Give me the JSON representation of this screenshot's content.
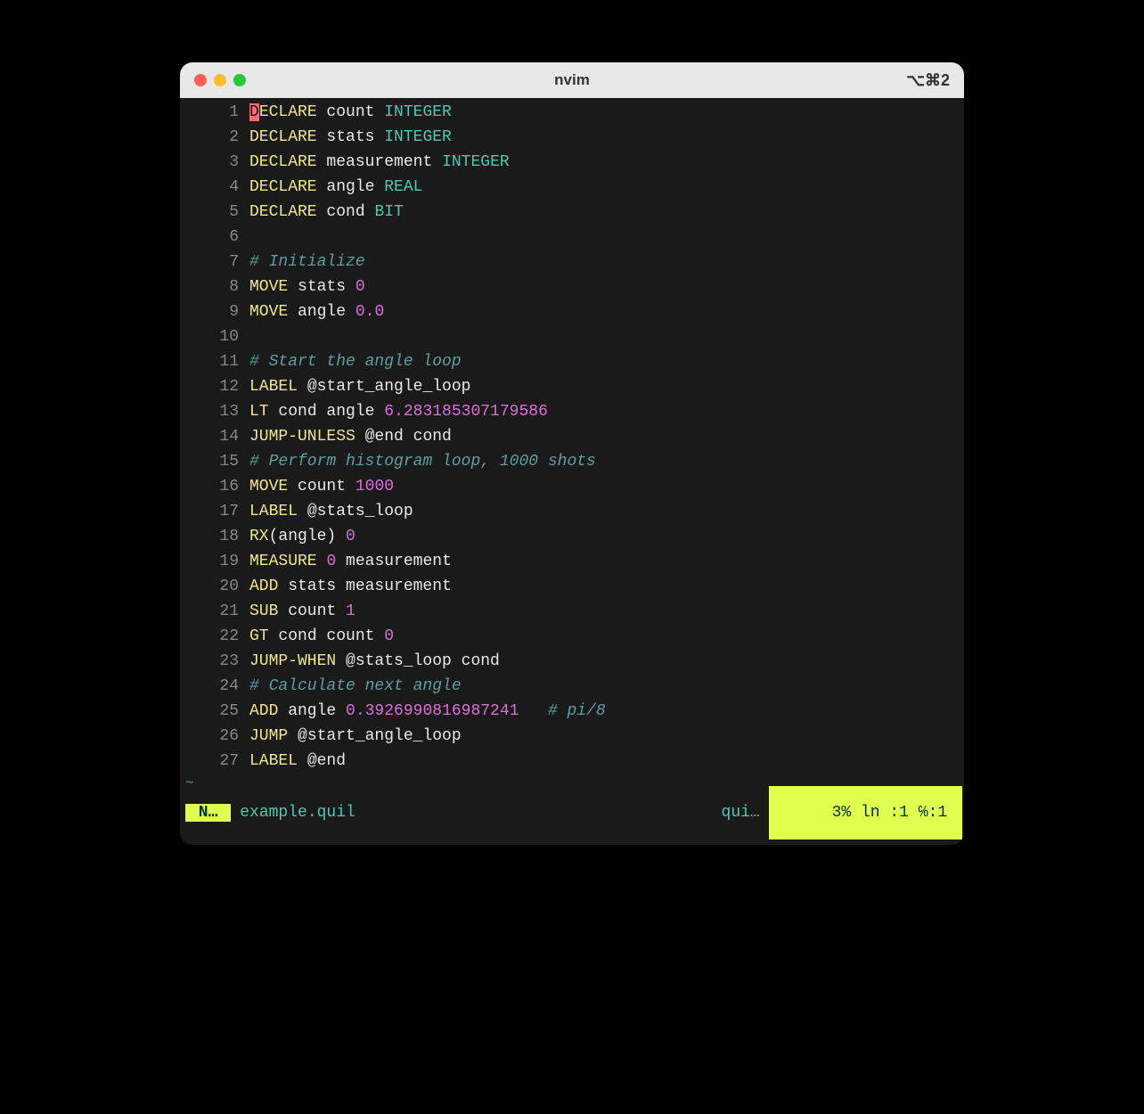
{
  "window": {
    "title": "nvim",
    "shortcut": "⌥⌘2"
  },
  "statusbar": {
    "mode": " N… ",
    "filename": "example.quil",
    "filetype": "qui…",
    "percent": "3%",
    "position": " ln :1 ℅:1 "
  },
  "tilde": "~",
  "lines": [
    {
      "num": "1",
      "tokens": [
        [
          "cursor",
          "D"
        ],
        [
          "kw",
          "ECLARE"
        ],
        [
          "ident",
          " count "
        ],
        [
          "type",
          "INTEGER"
        ]
      ]
    },
    {
      "num": "2",
      "tokens": [
        [
          "kw",
          "DECLARE"
        ],
        [
          "ident",
          " stats "
        ],
        [
          "type",
          "INTEGER"
        ]
      ]
    },
    {
      "num": "3",
      "tokens": [
        [
          "kw",
          "DECLARE"
        ],
        [
          "ident",
          " measurement "
        ],
        [
          "type",
          "INTEGER"
        ]
      ]
    },
    {
      "num": "4",
      "tokens": [
        [
          "kw",
          "DECLARE"
        ],
        [
          "ident",
          " angle "
        ],
        [
          "type",
          "REAL"
        ]
      ]
    },
    {
      "num": "5",
      "tokens": [
        [
          "kw",
          "DECLARE"
        ],
        [
          "ident",
          " cond "
        ],
        [
          "type",
          "BIT"
        ]
      ]
    },
    {
      "num": "6",
      "tokens": []
    },
    {
      "num": "7",
      "tokens": [
        [
          "comment",
          "# Initialize"
        ]
      ]
    },
    {
      "num": "8",
      "tokens": [
        [
          "kw",
          "MOVE"
        ],
        [
          "ident",
          " stats "
        ],
        [
          "num",
          "0"
        ]
      ]
    },
    {
      "num": "9",
      "tokens": [
        [
          "kw",
          "MOVE"
        ],
        [
          "ident",
          " angle "
        ],
        [
          "num",
          "0.0"
        ]
      ]
    },
    {
      "num": "10",
      "tokens": []
    },
    {
      "num": "11",
      "tokens": [
        [
          "comment",
          "# Start the angle loop"
        ]
      ]
    },
    {
      "num": "12",
      "tokens": [
        [
          "kw",
          "LABEL"
        ],
        [
          "ident",
          " @start_angle_loop"
        ]
      ]
    },
    {
      "num": "13",
      "tokens": [
        [
          "kw",
          "LT"
        ],
        [
          "ident",
          " cond angle "
        ],
        [
          "num",
          "6.283185307179586"
        ]
      ]
    },
    {
      "num": "14",
      "tokens": [
        [
          "kw",
          "JUMP-UNLESS"
        ],
        [
          "ident",
          " @end cond"
        ]
      ]
    },
    {
      "num": "15",
      "tokens": [
        [
          "comment",
          "# Perform histogram loop, 1000 shots"
        ]
      ]
    },
    {
      "num": "16",
      "tokens": [
        [
          "kw",
          "MOVE"
        ],
        [
          "ident",
          " count "
        ],
        [
          "num",
          "1000"
        ]
      ]
    },
    {
      "num": "17",
      "tokens": [
        [
          "kw",
          "LABEL"
        ],
        [
          "ident",
          " @stats_loop"
        ]
      ]
    },
    {
      "num": "18",
      "tokens": [
        [
          "kw",
          "RX"
        ],
        [
          "ident",
          "(angle) "
        ],
        [
          "num",
          "0"
        ]
      ]
    },
    {
      "num": "19",
      "tokens": [
        [
          "kw",
          "MEASURE"
        ],
        [
          "ident",
          " "
        ],
        [
          "num",
          "0"
        ],
        [
          "ident",
          " measurement"
        ]
      ]
    },
    {
      "num": "20",
      "tokens": [
        [
          "kw",
          "ADD"
        ],
        [
          "ident",
          " stats measurement"
        ]
      ]
    },
    {
      "num": "21",
      "tokens": [
        [
          "kw",
          "SUB"
        ],
        [
          "ident",
          " count "
        ],
        [
          "num",
          "1"
        ]
      ]
    },
    {
      "num": "22",
      "tokens": [
        [
          "kw",
          "GT"
        ],
        [
          "ident",
          " cond count "
        ],
        [
          "num",
          "0"
        ]
      ]
    },
    {
      "num": "23",
      "tokens": [
        [
          "kw",
          "JUMP-WHEN"
        ],
        [
          "ident",
          " @stats_loop cond"
        ]
      ]
    },
    {
      "num": "24",
      "tokens": [
        [
          "comment",
          "# Calculate next angle"
        ]
      ]
    },
    {
      "num": "25",
      "tokens": [
        [
          "kw",
          "ADD"
        ],
        [
          "ident",
          " angle "
        ],
        [
          "num",
          "0.3926990816987241"
        ],
        [
          "ident",
          "   "
        ],
        [
          "comment",
          "# pi/8"
        ]
      ]
    },
    {
      "num": "26",
      "tokens": [
        [
          "kw",
          "JUMP"
        ],
        [
          "ident",
          " @start_angle_loop"
        ]
      ]
    },
    {
      "num": "27",
      "tokens": [
        [
          "kw",
          "LABEL"
        ],
        [
          "ident",
          " @end"
        ]
      ]
    }
  ]
}
